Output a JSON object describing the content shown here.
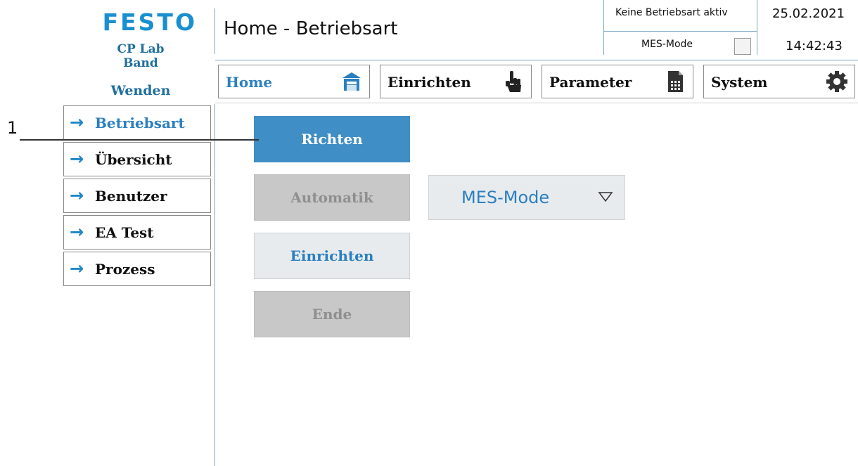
{
  "brand": {
    "logo": "FESTO",
    "line1": "CP Lab",
    "line2": "Band",
    "line3": "Wenden"
  },
  "header": {
    "title": "Home - Betriebsart",
    "mode_status": "Keine Betriebsart aktiv",
    "mes_mode_label": "MES-Mode",
    "date": "25.02.2021",
    "time": "14:42:43"
  },
  "nav": [
    {
      "label": "Home",
      "icon": "home-icon"
    },
    {
      "label": "Einrichten",
      "icon": "hand-pointer-icon"
    },
    {
      "label": "Parameter",
      "icon": "document-icon"
    },
    {
      "label": "System",
      "icon": "gear-icon"
    }
  ],
  "sidebar": [
    {
      "label": "Betriebsart",
      "active": true
    },
    {
      "label": "Übersicht",
      "active": false
    },
    {
      "label": "Benutzer",
      "active": false
    },
    {
      "label": "EA Test",
      "active": false
    },
    {
      "label": "Prozess",
      "active": false
    }
  ],
  "modes": {
    "richten": "Richten",
    "automatik": "Automatik",
    "einrichten": "Einrichten",
    "ende": "Ende"
  },
  "mes_dropdown": {
    "value": "MES-Mode"
  },
  "annotation": {
    "number": "1"
  },
  "colors": {
    "accent": "#3f8ec5",
    "link": "#2a7fc0",
    "brand": "#1a8fd0",
    "disabled": "#c8c8c8"
  }
}
